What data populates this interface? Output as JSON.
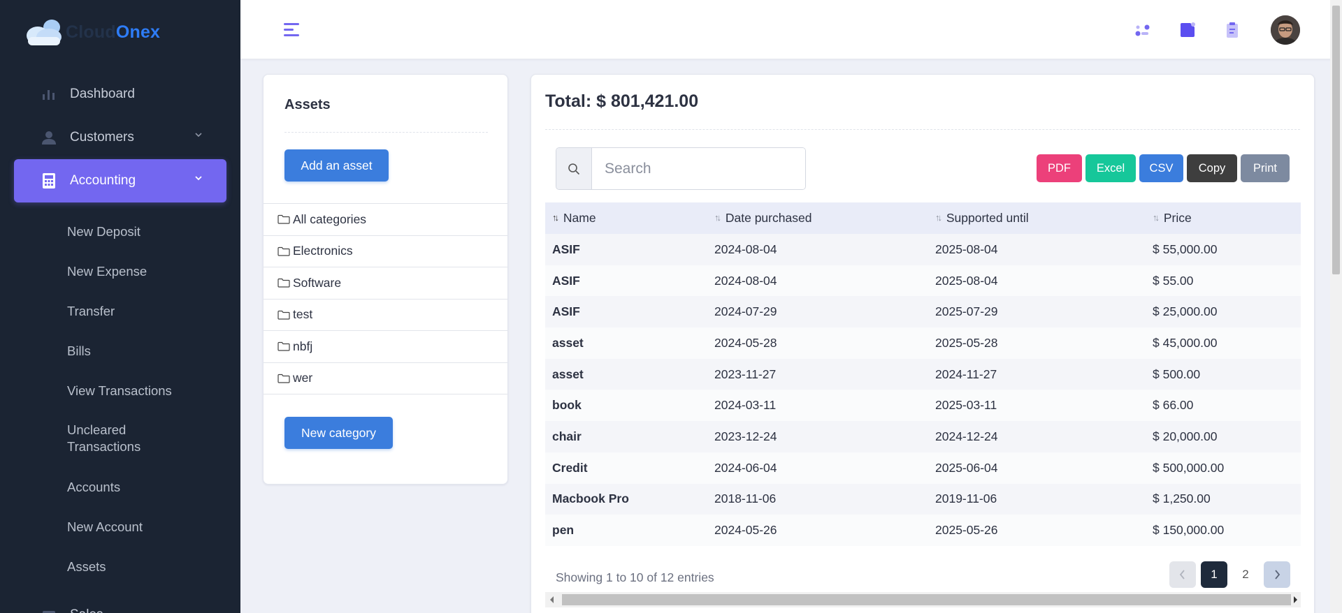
{
  "brand": {
    "name_part1": "Cloud",
    "name_part2": "Onex"
  },
  "sidebar": {
    "items": [
      {
        "label": "Dashboard",
        "icon": "bar-chart-icon"
      },
      {
        "label": "Customers",
        "icon": "user-icon"
      },
      {
        "label": "Accounting",
        "icon": "calculator-icon",
        "active": true
      },
      {
        "label": "Sales",
        "icon": "cart-icon"
      }
    ],
    "subitems": [
      "New Deposit",
      "New Expense",
      "Transfer",
      "Bills",
      "View Transactions",
      "Uncleared\nTransactions",
      "Accounts",
      "New Account",
      "Assets"
    ]
  },
  "assets_panel": {
    "title": "Assets",
    "add_button": "Add an asset",
    "categories": [
      "All categories",
      "Electronics",
      "Software",
      "test",
      "nbfj",
      "wer"
    ],
    "new_category_button": "New category"
  },
  "main": {
    "total": "Total: $ 801,421.00",
    "search": {
      "placeholder": "Search",
      "value": ""
    },
    "export_buttons": [
      {
        "label": "PDF",
        "color": "#ec407a"
      },
      {
        "label": "Excel",
        "color": "#16c79a"
      },
      {
        "label": "CSV",
        "color": "#3b7ddd"
      },
      {
        "label": "Copy",
        "color": "#3e3e3e"
      },
      {
        "label": "Print",
        "color": "#7d8aa0"
      }
    ],
    "table": {
      "columns": [
        "Name",
        "Date purchased",
        "Supported until",
        "Price"
      ],
      "rows": [
        [
          "ASIF",
          "2024-08-04",
          "2025-08-04",
          "$ 55,000.00"
        ],
        [
          "ASIF",
          "2024-08-04",
          "2025-08-04",
          "$ 55.00"
        ],
        [
          "ASIF",
          "2024-07-29",
          "2025-07-29",
          "$ 25,000.00"
        ],
        [
          "asset",
          "2024-05-28",
          "2025-05-28",
          "$ 45,000.00"
        ],
        [
          "asset",
          "2023-11-27",
          "2024-11-27",
          "$ 500.00"
        ],
        [
          "book",
          "2024-03-11",
          "2025-03-11",
          "$ 66.00"
        ],
        [
          "chair",
          "2023-12-24",
          "2024-12-24",
          "$ 20,000.00"
        ],
        [
          "Credit",
          "2024-06-04",
          "2025-06-04",
          "$ 500,000.00"
        ],
        [
          "Macbook Pro",
          "2018-11-06",
          "2019-11-06",
          "$ 1,250.00"
        ],
        [
          "pen",
          "2024-05-26",
          "2025-05-26",
          "$ 150,000.00"
        ]
      ]
    },
    "showing": "Showing 1 to 10 of 12 entries",
    "pagination": {
      "pages": [
        "1",
        "2"
      ],
      "current": "1"
    }
  },
  "colors": {
    "accent": "#7367f0",
    "primary": "#3b7ddd",
    "sidebar_bg": "#1b2433"
  }
}
